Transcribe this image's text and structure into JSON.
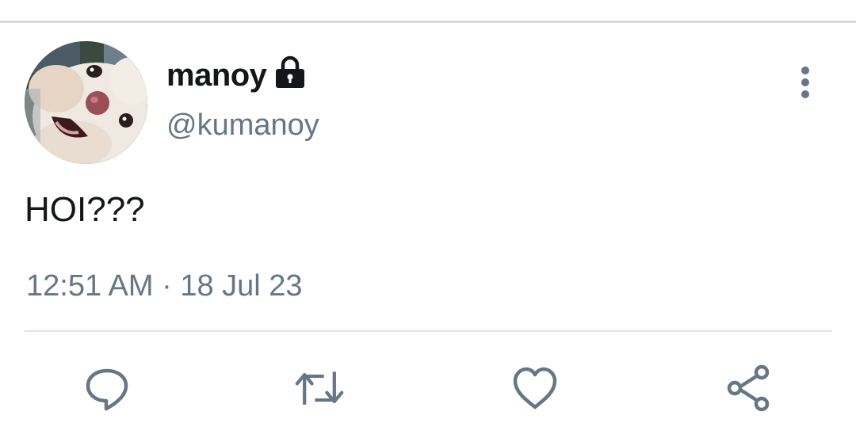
{
  "tweet": {
    "author": {
      "display_name": "manoy",
      "handle": "@kumanoy",
      "protected": true
    },
    "text": "HOI???",
    "timestamp": "12:51 AM · 18 Jul 23"
  },
  "actions": [
    "reply",
    "retweet",
    "like",
    "share"
  ],
  "colors": {
    "primary_text": "#14171a",
    "secondary_text": "#657786",
    "icon": "#657786",
    "divider": "#e1e4e8"
  }
}
